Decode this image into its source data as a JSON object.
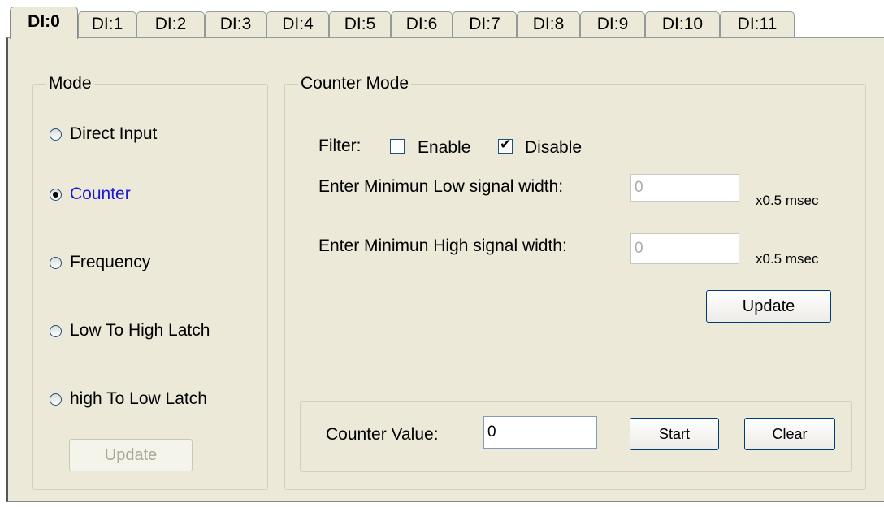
{
  "tabs": [
    "DI:0",
    "DI:1",
    "DI:2",
    "DI:3",
    "DI:4",
    "DI:5",
    "DI:6",
    "DI:7",
    "DI:8",
    "DI:9",
    "DI:10",
    "DI:11"
  ],
  "mode": {
    "title": "Mode",
    "options": [
      "Direct Input",
      "Counter",
      "Frequency",
      "Low To High Latch",
      "high To Low Latch"
    ],
    "selected": "Counter",
    "update_label": "Update"
  },
  "counter_mode": {
    "title": "Counter Mode",
    "filter_label": "Filter:",
    "enable_label": "Enable",
    "disable_label": "Disable",
    "low_width_label": "Enter Minimun Low signal width:",
    "low_width_value": "0",
    "high_width_label": "Enter Minimun High signal width:",
    "high_width_value": "0",
    "unit": "x0.5 msec",
    "update_label": "Update",
    "counter_value_label": "Counter Value:",
    "counter_value": "0",
    "start_label": "Start",
    "clear_label": "Clear"
  }
}
